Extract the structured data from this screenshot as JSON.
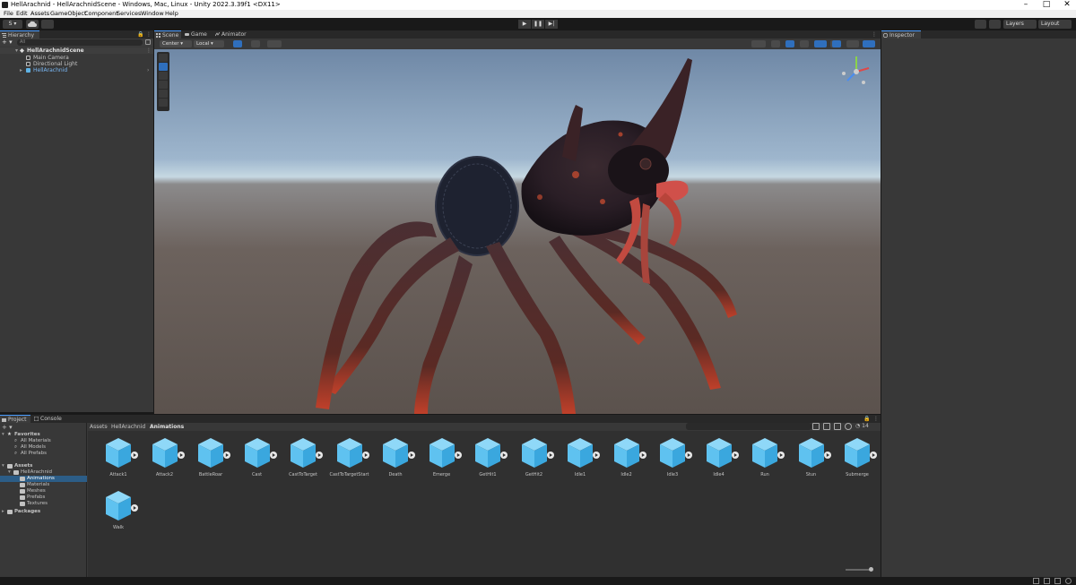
{
  "window": {
    "title": "HellArachnid - HellArachnidScene - Windows, Mac, Linux - Unity 2022.3.39f1 <DX11>",
    "minimize": "–",
    "maximize": "□",
    "close": "✕"
  },
  "menu": [
    "File",
    "Edit",
    "Assets",
    "GameObject",
    "Component",
    "Services",
    "Window",
    "Help"
  ],
  "toolbar": {
    "account": "S ▾",
    "layers": "Layers",
    "layout": "Layout",
    "play_icon": "▶",
    "pause_icon": "❚❚",
    "step_icon": "▶|"
  },
  "hierarchy": {
    "tab": "Hierarchy",
    "search_placeholder": "All",
    "rows": [
      {
        "label": "HellArachnidScene",
        "kind": "scene"
      },
      {
        "label": "Main Camera",
        "kind": "object"
      },
      {
        "label": "Directional Light",
        "kind": "object"
      },
      {
        "label": "HellArachnid",
        "kind": "prefab"
      }
    ]
  },
  "scene": {
    "tabs": [
      "Scene",
      "Game",
      "Animator"
    ],
    "pivot": "Center",
    "space": "Local"
  },
  "inspector": {
    "tab": "Inspector"
  },
  "project": {
    "tabs": [
      "Project",
      "Console"
    ],
    "tree": {
      "favorites": "Favorites",
      "favorites_items": [
        "All Materials",
        "All Models",
        "All Prefabs"
      ],
      "assets": "Assets",
      "folder": "HellArachnid",
      "subfolders": [
        "Animations",
        "Materials",
        "Meshes",
        "Prefabs",
        "Textures"
      ],
      "packages": "Packages"
    },
    "breadcrumb": [
      "Assets",
      "HellArachnid",
      "Animations"
    ],
    "hidden_count": "14",
    "assets": [
      "Attack1",
      "Attack2",
      "BattleRoar",
      "Cast",
      "CastToTarget",
      "CastToTargetStart",
      "Death",
      "Emerge",
      "GetHit1",
      "GetHit2",
      "Idle1",
      "Idle2",
      "Idle3",
      "Idle4",
      "Run",
      "Stun",
      "Submerge",
      "Walk"
    ]
  },
  "colors": {
    "accent": "#4a9cff",
    "selection": "#2c5d87",
    "asset_cube": "#5fc2f0"
  }
}
